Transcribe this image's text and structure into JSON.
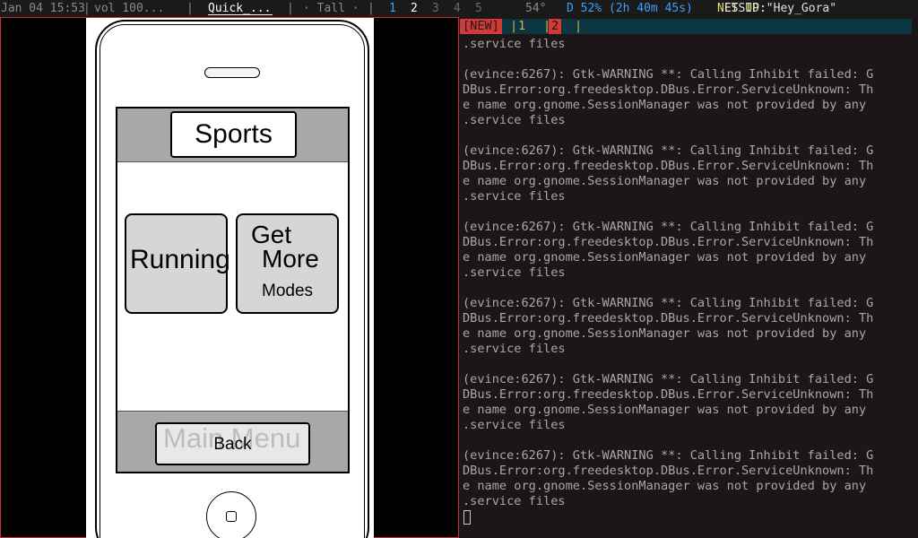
{
  "statusbar": {
    "date": "Jan 04 15:53",
    "sep1": "|",
    "volume": "vol 100...",
    "sep2": "|",
    "window_title": "Quick_...",
    "sep3": "|",
    "layout": "· Tall ·",
    "sep4": "|",
    "workspaces": [
      "1",
      "2",
      "3",
      "4",
      "5"
    ],
    "temperature": "54°",
    "battery": "D 52% (2h 40m 45s)",
    "network_label": "NET UP:",
    "essid": "ESSID:\"Hey_Gora\""
  },
  "mockup": {
    "header_title": "Sports",
    "running_label": "Running",
    "getmore_line1": "Get",
    "getmore_line2": "More",
    "getmore_line3": "Modes",
    "footer_ghost_text": "Main Menu",
    "back_label": "Back"
  },
  "terminal": {
    "tabs": {
      "new": "[NEW]",
      "t1": "1",
      "t2": "2",
      "sep": "|"
    },
    "output": ".service files\n\n(evince:6267): Gtk-WARNING **: Calling Inhibit failed: G\nDBus.Error:org.freedesktop.DBus.Error.ServiceUnknown: Th\ne name org.gnome.SessionManager was not provided by any\n.service files\n\n(evince:6267): Gtk-WARNING **: Calling Inhibit failed: G\nDBus.Error:org.freedesktop.DBus.Error.ServiceUnknown: Th\ne name org.gnome.SessionManager was not provided by any\n.service files\n\n(evince:6267): Gtk-WARNING **: Calling Inhibit failed: G\nDBus.Error:org.freedesktop.DBus.Error.ServiceUnknown: Th\ne name org.gnome.SessionManager was not provided by any\n.service files\n\n(evince:6267): Gtk-WARNING **: Calling Inhibit failed: G\nDBus.Error:org.freedesktop.DBus.Error.ServiceUnknown: Th\ne name org.gnome.SessionManager was not provided by any\n.service files\n\n(evince:6267): Gtk-WARNING **: Calling Inhibit failed: G\nDBus.Error:org.freedesktop.DBus.Error.ServiceUnknown: Th\ne name org.gnome.SessionManager was not provided by any\n.service files\n\n(evince:6267): Gtk-WARNING **: Calling Inhibit failed: G\nDBus.Error:org.freedesktop.DBus.Error.ServiceUnknown: Th\ne name org.gnome.SessionManager was not provided by any\n.service files"
  },
  "colors": {
    "active_border": "#c8303a",
    "workspace_active": "#3aa0ff",
    "net_up": "#e0e070",
    "tab_highlight": "#d23a3a",
    "tab_bar": "#0b3540",
    "terminal_bg": "#1c1616"
  }
}
